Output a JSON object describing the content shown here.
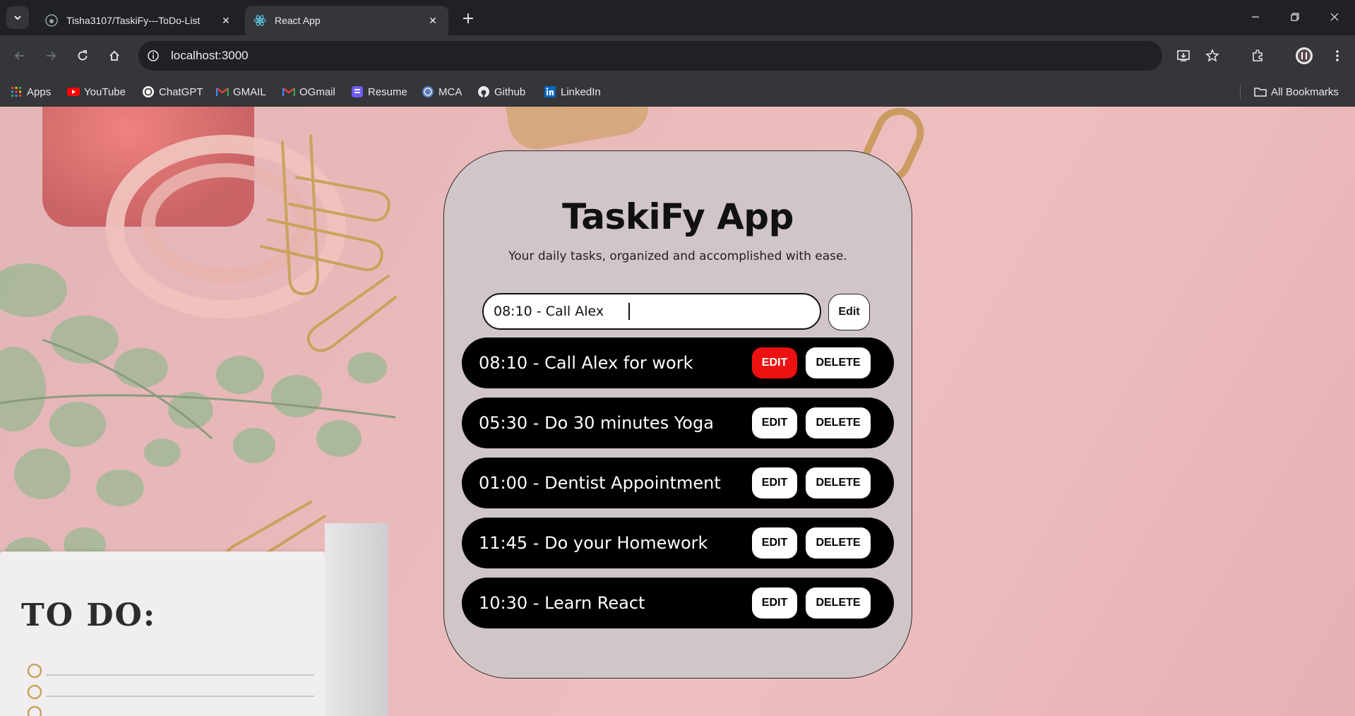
{
  "browser": {
    "tabs": [
      {
        "title": "Tisha3107/TaskiFy---ToDo-List",
        "icon": "github-icon",
        "active": false
      },
      {
        "title": "React App",
        "icon": "react-icon",
        "active": true
      }
    ],
    "url": "localhost:3000",
    "bookmarks": [
      {
        "label": "Apps",
        "icon": "apps-grid-icon"
      },
      {
        "label": "YouTube",
        "icon": "youtube-icon"
      },
      {
        "label": "ChatGPT",
        "icon": "chatgpt-icon"
      },
      {
        "label": "GMAIL",
        "icon": "gmail-icon"
      },
      {
        "label": "OGmail",
        "icon": "gmail-icon"
      },
      {
        "label": "Resume",
        "icon": "resume-icon"
      },
      {
        "label": "MCA",
        "icon": "mca-icon"
      },
      {
        "label": "Github",
        "icon": "github-icon"
      },
      {
        "label": "LinkedIn",
        "icon": "linkedin-icon"
      }
    ],
    "all_bookmarks": "All Bookmarks"
  },
  "app": {
    "title": "TaskiFy App",
    "subtitle": "Your daily tasks, organized and accomplished with ease.",
    "input_value": "08:10 - Call Alex ",
    "edit_button": "Edit",
    "edit_label": "EDIT",
    "delete_label": "DELETE",
    "tasks": [
      {
        "text": "08:10 - Call Alex for work",
        "editing": true
      },
      {
        "text": "05:30 - Do 30 minutes Yoga",
        "editing": false
      },
      {
        "text": "01:00 - Dentist Appointment",
        "editing": false
      },
      {
        "text": "11:45 - Do your Homework",
        "editing": false
      },
      {
        "text": "10:30 - Learn React",
        "editing": false
      }
    ]
  },
  "background": {
    "notepad_heading": "TO DO:"
  },
  "colors": {
    "accent_red": "#ee1111",
    "card_bg": "#d0c6c7",
    "task_bg": "#000000",
    "page_bg": "#eab9ba"
  }
}
